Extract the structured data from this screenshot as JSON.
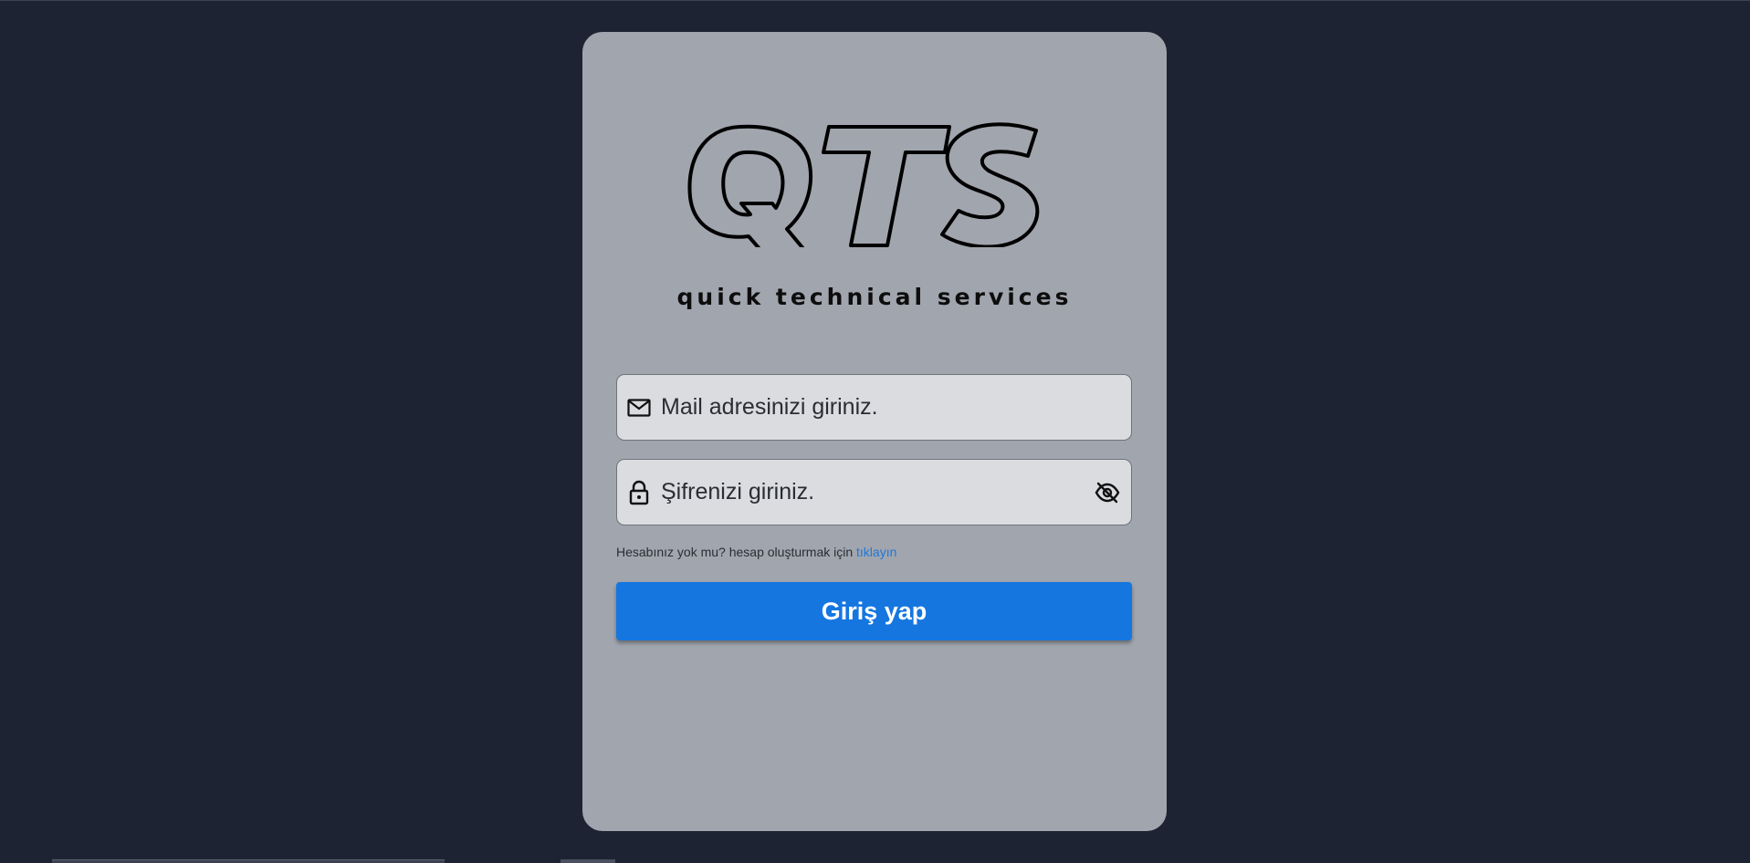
{
  "colors": {
    "background": "#1e2333",
    "card": "#a1a5ae",
    "input_bg": "#dbdcdf",
    "primary_button": "#1576e0",
    "link": "#1f78d8"
  },
  "logo": {
    "letters": "QTS",
    "tagline": "quick technical services"
  },
  "login_form": {
    "email": {
      "placeholder": "Mail adresinizi giriniz.",
      "value": "",
      "icon": "mail-icon"
    },
    "password": {
      "placeholder": "Şifrenizi giriniz.",
      "value": "",
      "icon": "lock-icon",
      "toggle_icon": "eye-off-icon"
    },
    "signup_prompt": "Hesabınız yok mu? hesap oluşturmak için",
    "signup_link": "tıklayın",
    "submit_label": "Giriş yap"
  }
}
